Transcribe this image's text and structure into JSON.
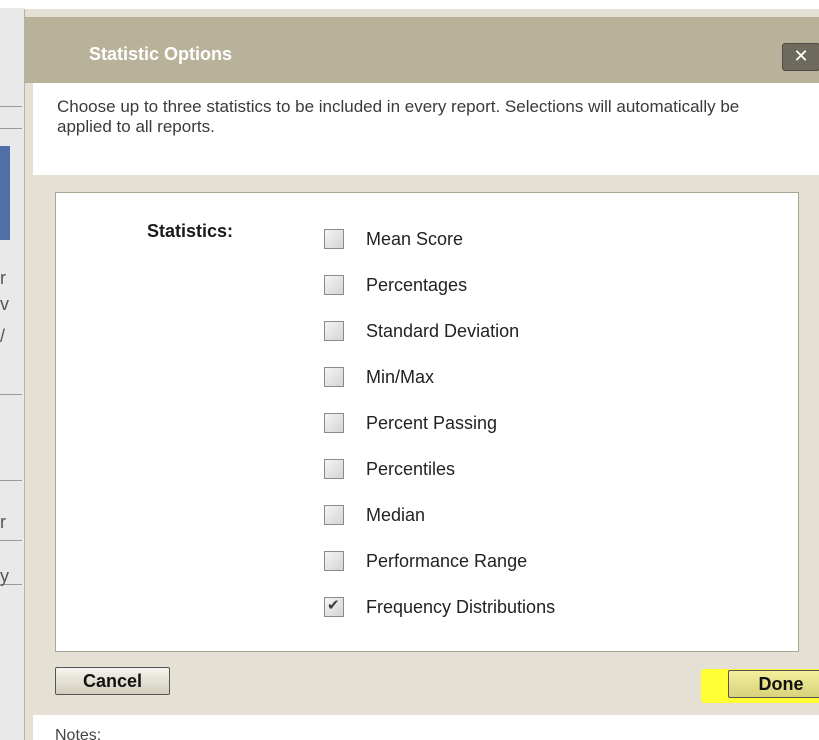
{
  "dialog": {
    "title": "Statistic Options",
    "close_label": "✕",
    "description": "Choose up to three statistics to be included in every report. Selections will automatically be applied to all reports."
  },
  "statistics": {
    "label": "Statistics:",
    "options": [
      {
        "label": "Mean Score",
        "checked": false
      },
      {
        "label": "Percentages",
        "checked": false
      },
      {
        "label": "Standard Deviation",
        "checked": false
      },
      {
        "label": "Min/Max",
        "checked": false
      },
      {
        "label": "Percent Passing",
        "checked": false
      },
      {
        "label": "Percentiles",
        "checked": false
      },
      {
        "label": "Median",
        "checked": false
      },
      {
        "label": "Performance Range",
        "checked": false
      },
      {
        "label": "Frequency Distributions",
        "checked": true
      }
    ]
  },
  "footer": {
    "cancel_label": "Cancel",
    "done_label": "Done",
    "notes_label": "Notes:"
  },
  "colors": {
    "titlebar": "#b8b29a",
    "dialog_bg": "#e4e0d4",
    "highlight": "#ffff33"
  },
  "background": {
    "visible_chars": [
      "r",
      "v",
      "/",
      "r",
      "y"
    ]
  }
}
